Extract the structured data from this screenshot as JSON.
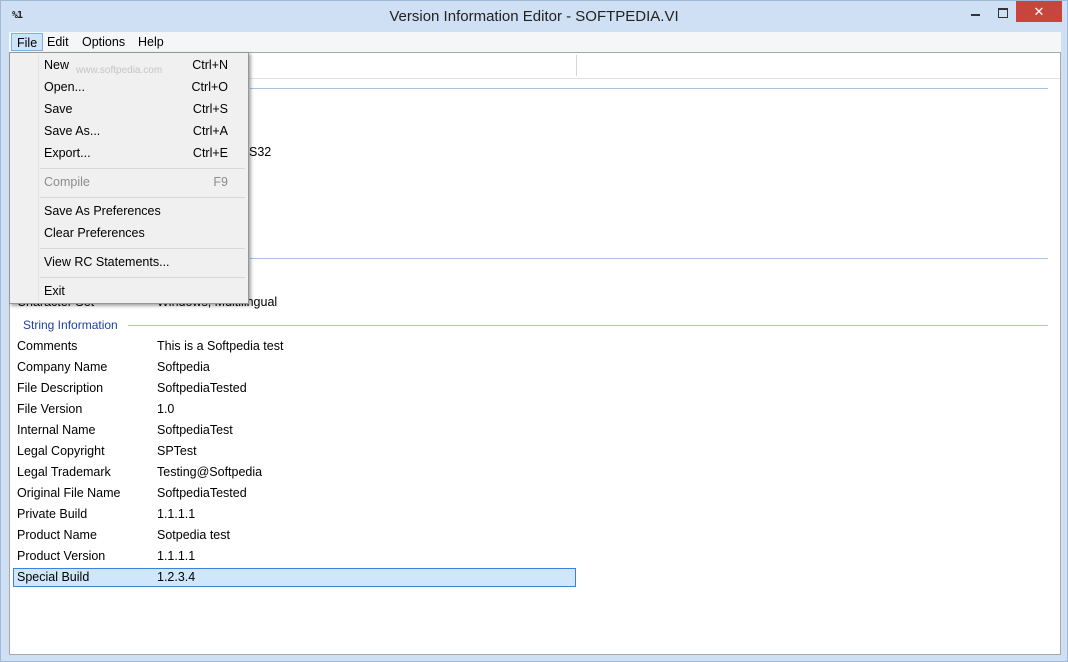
{
  "window": {
    "title": "Version Information Editor - SOFTPEDIA.VI",
    "icon_text": "%1",
    "close_glyph": "✕"
  },
  "menubar": {
    "items": [
      "File",
      "Edit",
      "Options",
      "Help"
    ]
  },
  "file_menu": {
    "items": [
      {
        "label": "New",
        "shortcut": "Ctrl+N",
        "enabled": true
      },
      {
        "label": "Open...",
        "shortcut": "Ctrl+O",
        "enabled": true
      },
      {
        "label": "Save",
        "shortcut": "Ctrl+S",
        "enabled": true
      },
      {
        "label": "Save As...",
        "shortcut": "Ctrl+A",
        "enabled": true
      },
      {
        "label": "Export...",
        "shortcut": "Ctrl+E",
        "enabled": true
      },
      {
        "label": "Compile",
        "shortcut": "F9",
        "enabled": false
      },
      {
        "label": "Save As Preferences",
        "enabled": true
      },
      {
        "label": "Clear Preferences",
        "enabled": true
      },
      {
        "label": "View RC Statements...",
        "enabled": true
      },
      {
        "label": "Exit",
        "enabled": true
      }
    ],
    "watermark": "www.softpedia.com"
  },
  "obscured": {
    "fragment_s32": "S32",
    "fragment_charset_label": "Character Set",
    "fragment_charset_value": "Windows, Multilingual"
  },
  "string_information": {
    "heading": "String Information",
    "rows": [
      {
        "label": "Comments",
        "value": "This is a Softpedia test"
      },
      {
        "label": "Company Name",
        "value": "Softpedia"
      },
      {
        "label": "File Description",
        "value": "SoftpediaTested"
      },
      {
        "label": "File Version",
        "value": "1.0"
      },
      {
        "label": "Internal Name",
        "value": "SoftpediaTest"
      },
      {
        "label": "Legal Copyright",
        "value": "SPTest"
      },
      {
        "label": "Legal Trademark",
        "value": "Testing@Softpedia"
      },
      {
        "label": "Original File Name",
        "value": "SoftpediaTested"
      },
      {
        "label": "Private Build",
        "value": "1.1.1.1"
      },
      {
        "label": "Product Name",
        "value": "Sotpedia test"
      },
      {
        "label": "Product Version",
        "value": "1.1.1.1"
      },
      {
        "label": "Special Build",
        "value": "1.2.3.4",
        "selected": true
      }
    ]
  },
  "colors": {
    "frame": "#cfe0f5",
    "close_button": "#c7453d",
    "section_heading": "#1f3f9f",
    "selection_fill": "#cfe6fb",
    "selection_border": "#3b82d8"
  }
}
